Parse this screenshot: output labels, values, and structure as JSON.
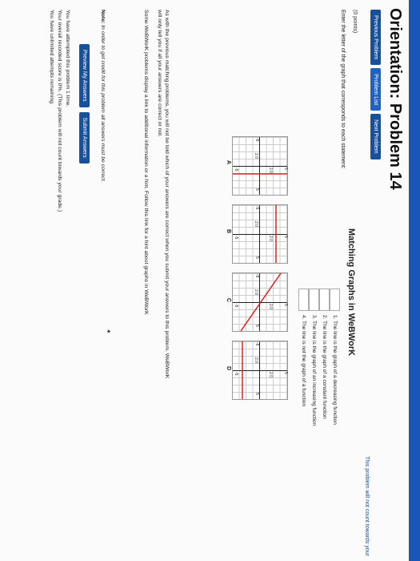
{
  "page": {
    "title": "Orientation: Problem 14",
    "nav": {
      "previous": "Previous Problem",
      "list": "Problem List",
      "next": "Next Problem"
    },
    "no_count_note": "This problem will not count towards your",
    "points": "(0 points)",
    "heading": "Matching Graphs in WeBWorK",
    "instruction": "Enter the letter of the graph that corresponds to each statement:",
    "statements": [
      "1. The line is the graph of a decreasing function",
      "2. The line is the graph of a constant function",
      "3. The line is the graph of an increasing function",
      "4. The line is not the graph of a function"
    ],
    "answers": [
      "",
      "",
      "",
      ""
    ],
    "graph_labels": [
      "A",
      "B",
      "C",
      "D"
    ],
    "tick_labels": [
      "5",
      "-5",
      "-5",
      "5",
      "2.0",
      "2.0"
    ],
    "para1": "As with the previous matching problems, you will not be told which of your answers are correct when you submit your answers to this problem. WeBWorK",
    "para1b": "will only tell you if all your answers are correct or not.",
    "para2": "Some WeBWorK problems display a link to additional information or a hint. Follow this link for a hint about graphs in WeBWorK",
    "note_label": "Note:",
    "note_text": "In order to get credit for this problem all answers must be correct.",
    "buttons": {
      "preview": "Preview My Answers",
      "submit": "Submit Answers"
    },
    "attempts": "You have attempted this problem 1 time.",
    "score": "Your overall recorded score is 0%. (This problem will not count towards your grade.)",
    "remaining": "You have unlimited attempts remaining."
  },
  "colors": {
    "brand_blue": "#16519e",
    "graph_line": "#e02020",
    "link_blue": "#1a4fa0"
  }
}
